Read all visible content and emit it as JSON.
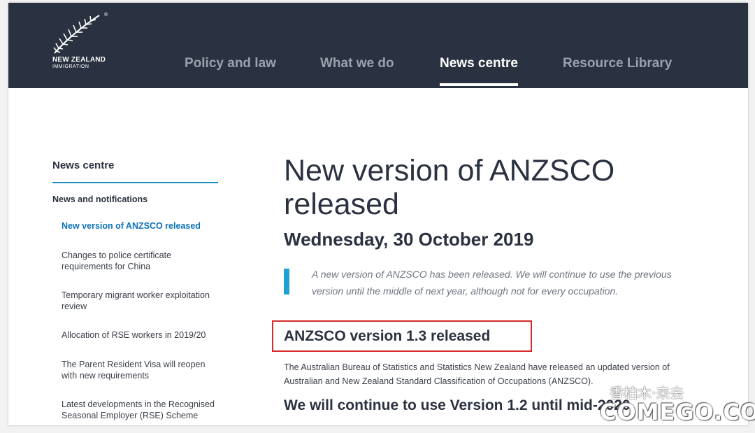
{
  "logo": {
    "line1": "NEW ZEALAND",
    "line2": "IMMIGRATION",
    "registered_mark": "®",
    "icon": "silver-fern-icon"
  },
  "nav": {
    "items": [
      {
        "label": "Policy and law",
        "active": false
      },
      {
        "label": "What we do",
        "active": false
      },
      {
        "label": "News centre",
        "active": true
      },
      {
        "label": "Resource Library",
        "active": false
      }
    ]
  },
  "sidebar": {
    "title": "News centre",
    "subtitle": "News and notifications",
    "items": [
      {
        "label": "New version of ANZSCO released",
        "active": true
      },
      {
        "label": "Changes to police certificate requirements for China",
        "active": false
      },
      {
        "label": "Temporary migrant worker exploitation review",
        "active": false
      },
      {
        "label": "Allocation of RSE workers in 2019/20",
        "active": false
      },
      {
        "label": "The Parent Resident Visa will reopen with new requirements",
        "active": false
      },
      {
        "label": "Latest developments in the Recognised Seasonal Employer (RSE) Scheme",
        "active": false
      }
    ]
  },
  "article": {
    "title": "New version of ANZSCO released",
    "date": "Wednesday, 30 October 2019",
    "intro": "A new version of ANZSCO has been released. We will continue to use the previous version until the middle of next year, although not for every occupation.",
    "heading1": "ANZSCO version 1.3 released",
    "paragraph1": "The Australian Bureau of Statistics and Statistics New Zealand have released an updated version of Australian and New Zealand Standard Classification of Occupations (ANZSCO).",
    "heading2": "We will continue to use Version 1.2 until mid-2020"
  },
  "watermark": {
    "cn": "香柏木·来去",
    "en": "COMEGO.COM"
  },
  "colors": {
    "header_bg": "#2a3140",
    "accent_blue": "#1fa0d6",
    "link_blue": "#0d72b9",
    "highlight_red": "#d62b2b"
  }
}
